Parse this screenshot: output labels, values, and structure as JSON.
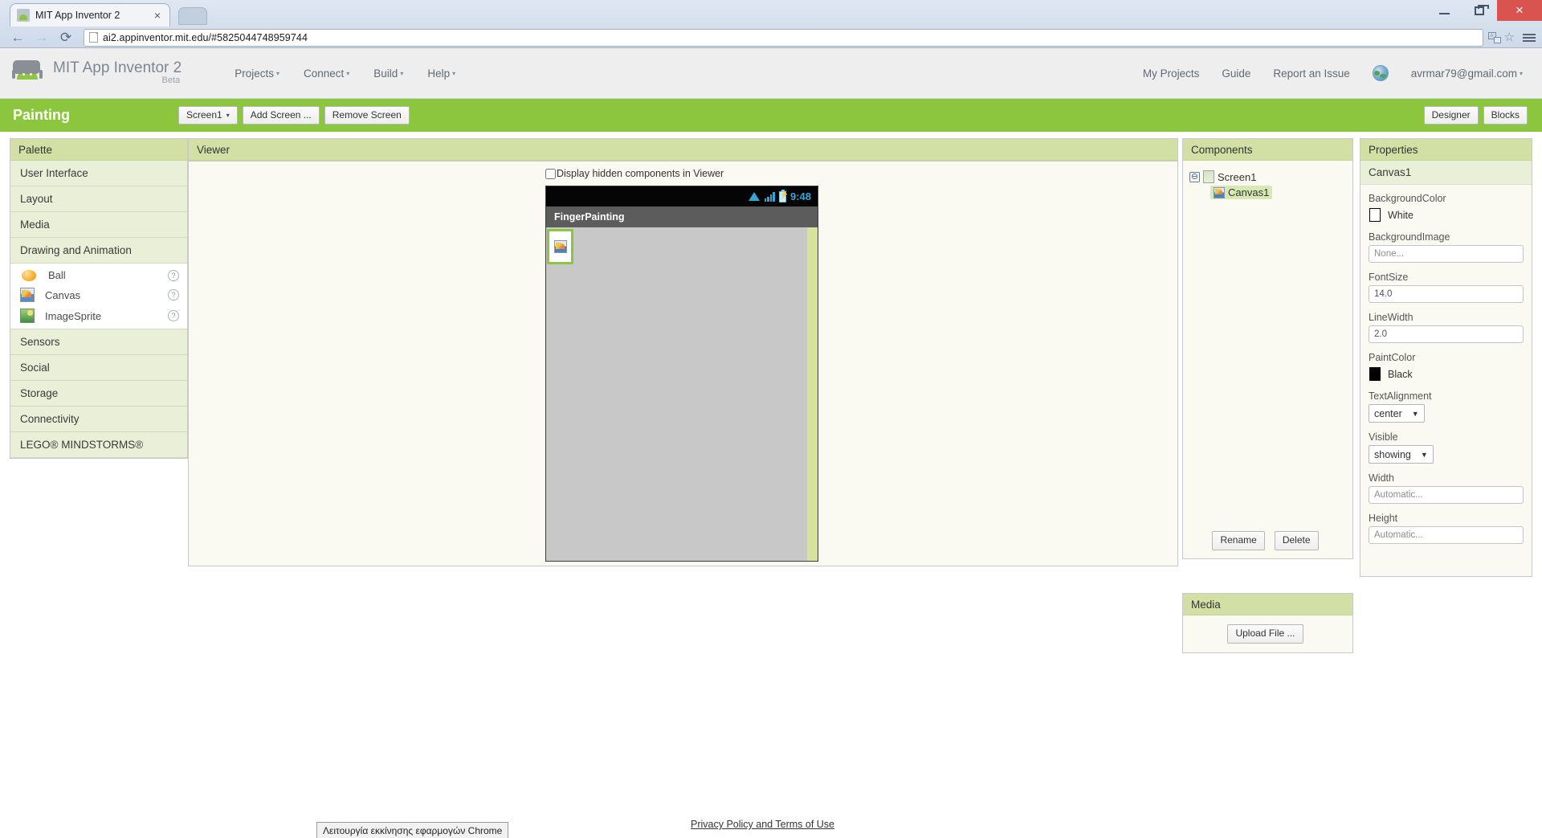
{
  "browser": {
    "tab_title": "MIT App Inventor 2",
    "tab_close": "×",
    "url": "ai2.appinventor.mit.edu/#5825044748959744",
    "back_icon": "←",
    "forward_icon": "→",
    "reload_icon": "⟳",
    "minimize_label": "–",
    "maximize_label": "❐",
    "close_label": "×",
    "star_icon": "☆",
    "translate_icon": "translate-icon",
    "menu_icon": "hamburger-menu-icon"
  },
  "header": {
    "brand_title": "MIT App Inventor 2",
    "brand_beta": "Beta",
    "nav": [
      {
        "label": "Projects",
        "caret": "▾"
      },
      {
        "label": "Connect",
        "caret": "▾"
      },
      {
        "label": "Build",
        "caret": "▾"
      },
      {
        "label": "Help",
        "caret": "▾"
      }
    ],
    "right": [
      {
        "label": "My Projects"
      },
      {
        "label": "Guide"
      },
      {
        "label": "Report an Issue"
      }
    ],
    "account": "avrmar79@gmail.com",
    "account_caret": "▾"
  },
  "project_bar": {
    "project_name": "Painting",
    "screen_select": "Screen1",
    "screen_caret": "▾",
    "add_screen": "Add Screen ...",
    "remove_screen": "Remove Screen",
    "designer": "Designer",
    "blocks": "Blocks"
  },
  "palette": {
    "title": "Palette",
    "sections": [
      {
        "label": "User Interface"
      },
      {
        "label": "Layout"
      },
      {
        "label": "Media"
      },
      {
        "label": "Drawing and Animation"
      },
      {
        "label": "Sensors"
      },
      {
        "label": "Social"
      },
      {
        "label": "Storage"
      },
      {
        "label": "Connectivity"
      },
      {
        "label": "LEGO® MINDSTORMS®"
      }
    ],
    "drawing_items": [
      {
        "label": "Ball",
        "icon": "ball-icon",
        "help": "?"
      },
      {
        "label": "Canvas",
        "icon": "canvas-icon",
        "help": "?"
      },
      {
        "label": "ImageSprite",
        "icon": "image-sprite-icon",
        "help": "?"
      }
    ]
  },
  "viewer": {
    "title": "Viewer",
    "hidden_components_label": "Display hidden components in Viewer",
    "phone": {
      "clock": "9:48",
      "app_title": "FingerPainting",
      "status_icons": [
        "wifi-icon",
        "signal-icon",
        "battery-icon"
      ]
    }
  },
  "components": {
    "title": "Components",
    "tree": [
      {
        "label": "Screen1",
        "icon": "screen-icon",
        "toggle": "⊖",
        "selected": false
      },
      {
        "label": "Canvas1",
        "icon": "canvas-icon",
        "selected": true
      }
    ],
    "rename_label": "Rename",
    "delete_label": "Delete"
  },
  "media": {
    "title": "Media",
    "upload_label": "Upload File ..."
  },
  "properties": {
    "title": "Properties",
    "component_name": "Canvas1",
    "items": [
      {
        "name": "BackgroundColor",
        "type": "color",
        "value": "White",
        "swatch": "white"
      },
      {
        "name": "BackgroundImage",
        "type": "input",
        "value": "None...",
        "placeholder": true
      },
      {
        "name": "FontSize",
        "type": "input",
        "value": "14.0",
        "placeholder": false
      },
      {
        "name": "LineWidth",
        "type": "input",
        "value": "2.0",
        "placeholder": false
      },
      {
        "name": "PaintColor",
        "type": "color",
        "value": "Black",
        "swatch": "black"
      },
      {
        "name": "TextAlignment",
        "type": "select",
        "value": "center",
        "caret": "▼"
      },
      {
        "name": "Visible",
        "type": "select",
        "value": "showing",
        "caret": "▼"
      },
      {
        "name": "Width",
        "type": "input",
        "value": "Automatic...",
        "placeholder": true
      },
      {
        "name": "Height",
        "type": "input",
        "value": "Automatic...",
        "placeholder": true
      }
    ]
  },
  "footer": {
    "privacy_link": "Privacy Policy and Terms of Use",
    "status_bubble": "Λειτουργία εκκίνησης εφαρμογών Chrome"
  },
  "colors": {
    "brand_green": "#8cc63e",
    "panel_header_green": "#d3e0a5",
    "section_green": "#eaf0d8",
    "selection_green": "#d7e8b4",
    "android_blue": "#36a4d4"
  }
}
